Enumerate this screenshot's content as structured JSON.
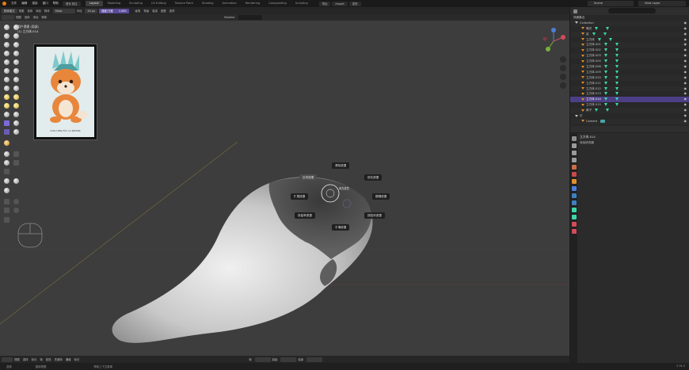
{
  "topbar": {
    "menu": [
      "文件",
      "编辑",
      "渲染",
      "窗口",
      "帮助"
    ],
    "menu_extra": "首页 前往",
    "workspaces": [
      {
        "label": "Layout",
        "active": true
      },
      {
        "label": "Modeling",
        "active": false
      },
      {
        "label": "Sculpting",
        "active": false
      },
      {
        "label": "UV Editing",
        "active": false
      },
      {
        "label": "Texture Paint",
        "active": false
      },
      {
        "label": "Shading",
        "active": false
      },
      {
        "label": "Animation",
        "active": false
      },
      {
        "label": "Rendering",
        "active": false
      },
      {
        "label": "Compositing",
        "active": false
      },
      {
        "label": "Scripting",
        "active": false
      }
    ],
    "btn_export": "导出",
    "btn_import": "Import",
    "btn_publish": "发布",
    "scene": "Scene",
    "view_layer": "View Layer"
  },
  "viewport_header": {
    "mode": "物体模式",
    "menus": [
      "视图",
      "选择",
      "添加",
      "物体"
    ],
    "brush": "Mask",
    "radius_label": "半径",
    "radius_value": "50 px",
    "strength_label": "强度/力度",
    "strength_value": "1.000",
    "right_menus": [
      "画笔",
      "笔画",
      "衰减",
      "遮罩",
      "选项"
    ],
    "modeler": "Modeler"
  },
  "overlay": {
    "line1": "用户透视 (局部)",
    "line2": "(1) 立方体.014"
  },
  "reference_caption": "Cute Little Fox on Wildlife",
  "pie_menu": {
    "top": "清除遮罩",
    "top_left": "反转遮罩",
    "top_right": "锐化遮罩",
    "left": "扩展遮罩",
    "right": "模糊遮罩",
    "bottom_left": "按曲率遮罩",
    "bottom_right": "按腔体遮罩",
    "bottom": "平滑遮罩",
    "cursor_label": "填充遮罩"
  },
  "viewport_footer": {
    "items": [
      "视图",
      "选择",
      "标记",
      "帧",
      "回放",
      "关键帧",
      "通道",
      "标记"
    ],
    "frame_label": "帧",
    "start_label": "起始",
    "end_label": "结束"
  },
  "statusbar": {
    "items": [
      "选择",
      "旋转视图",
      "物体上下文菜单"
    ],
    "version": "2.91.2"
  },
  "outliner": {
    "title": "场景集合",
    "rows": [
      {
        "label": "Collection",
        "indent": 0,
        "selected": false,
        "mod": ""
      },
      {
        "label": "嘴巴",
        "indent": 1,
        "selected": false,
        "mod": "tri"
      },
      {
        "label": "耳",
        "indent": 1,
        "selected": false,
        "mod": "tri"
      },
      {
        "label": "立方体",
        "indent": 1,
        "selected": false,
        "mod": "tri"
      },
      {
        "label": "立方体.001",
        "indent": 1,
        "selected": false,
        "mod": "tri"
      },
      {
        "label": "立方体.002",
        "indent": 1,
        "selected": false,
        "mod": "tri"
      },
      {
        "label": "立方体.003",
        "indent": 1,
        "selected": false,
        "mod": "tri"
      },
      {
        "label": "立方体.004",
        "indent": 1,
        "selected": false,
        "mod": "tri"
      },
      {
        "label": "立方体.008",
        "indent": 1,
        "selected": false,
        "mod": "tri"
      },
      {
        "label": "立方体.009",
        "indent": 1,
        "selected": false,
        "mod": "tri"
      },
      {
        "label": "立方体.010",
        "indent": 1,
        "selected": false,
        "mod": "tri"
      },
      {
        "label": "立方体.011",
        "indent": 1,
        "selected": false,
        "mod": "tri"
      },
      {
        "label": "立方体.012",
        "indent": 1,
        "selected": false,
        "mod": "tri"
      },
      {
        "label": "立方体.013",
        "indent": 1,
        "selected": false,
        "mod": "tri"
      },
      {
        "label": "立方体.014",
        "indent": 1,
        "selected": true,
        "mod": "tri"
      },
      {
        "label": "立方体.015",
        "indent": 1,
        "selected": false,
        "mod": "tri"
      },
      {
        "label": "鼻子",
        "indent": 1,
        "selected": false,
        "mod": "tri"
      },
      {
        "label": "灯",
        "indent": 0,
        "selected": false,
        "mod": ""
      },
      {
        "label": "Camera",
        "indent": 1,
        "selected": false,
        "mod": "cam"
      }
    ]
  },
  "properties": {
    "object_name": "立方体.014",
    "add_modifier": "添加修改器"
  },
  "colors": {
    "accent": "#5b4a9a",
    "selected_row": "#4d3f86",
    "mesh_light": "#e8e8e8",
    "mesh_dark": "#3a3a3a",
    "modifier_icon": "#3dd6a8",
    "object_icon": "#e0902f"
  }
}
